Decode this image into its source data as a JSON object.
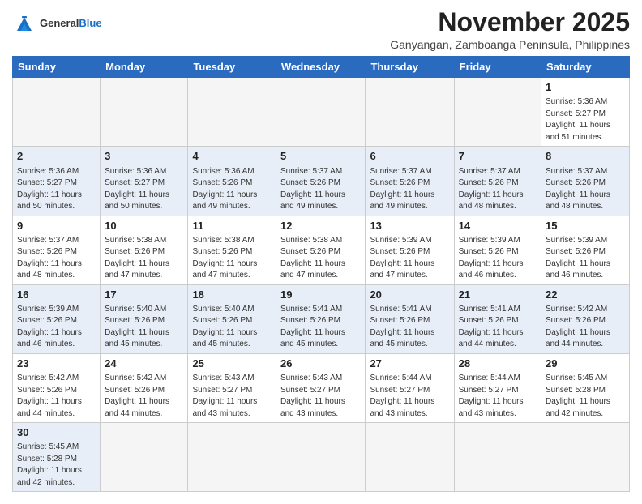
{
  "header": {
    "logo_general": "General",
    "logo_blue": "Blue",
    "month_title": "November 2025",
    "subtitle": "Ganyangan, Zamboanga Peninsula, Philippines"
  },
  "days_of_week": [
    "Sunday",
    "Monday",
    "Tuesday",
    "Wednesday",
    "Thursday",
    "Friday",
    "Saturday"
  ],
  "weeks": [
    [
      {
        "day": "",
        "info": ""
      },
      {
        "day": "",
        "info": ""
      },
      {
        "day": "",
        "info": ""
      },
      {
        "day": "",
        "info": ""
      },
      {
        "day": "",
        "info": ""
      },
      {
        "day": "",
        "info": ""
      },
      {
        "day": "1",
        "info": "Sunrise: 5:36 AM\nSunset: 5:27 PM\nDaylight: 11 hours\nand 51 minutes."
      }
    ],
    [
      {
        "day": "2",
        "info": "Sunrise: 5:36 AM\nSunset: 5:27 PM\nDaylight: 11 hours\nand 50 minutes."
      },
      {
        "day": "3",
        "info": "Sunrise: 5:36 AM\nSunset: 5:27 PM\nDaylight: 11 hours\nand 50 minutes."
      },
      {
        "day": "4",
        "info": "Sunrise: 5:36 AM\nSunset: 5:26 PM\nDaylight: 11 hours\nand 49 minutes."
      },
      {
        "day": "5",
        "info": "Sunrise: 5:37 AM\nSunset: 5:26 PM\nDaylight: 11 hours\nand 49 minutes."
      },
      {
        "day": "6",
        "info": "Sunrise: 5:37 AM\nSunset: 5:26 PM\nDaylight: 11 hours\nand 49 minutes."
      },
      {
        "day": "7",
        "info": "Sunrise: 5:37 AM\nSunset: 5:26 PM\nDaylight: 11 hours\nand 48 minutes."
      },
      {
        "day": "8",
        "info": "Sunrise: 5:37 AM\nSunset: 5:26 PM\nDaylight: 11 hours\nand 48 minutes."
      }
    ],
    [
      {
        "day": "9",
        "info": "Sunrise: 5:37 AM\nSunset: 5:26 PM\nDaylight: 11 hours\nand 48 minutes."
      },
      {
        "day": "10",
        "info": "Sunrise: 5:38 AM\nSunset: 5:26 PM\nDaylight: 11 hours\nand 47 minutes."
      },
      {
        "day": "11",
        "info": "Sunrise: 5:38 AM\nSunset: 5:26 PM\nDaylight: 11 hours\nand 47 minutes."
      },
      {
        "day": "12",
        "info": "Sunrise: 5:38 AM\nSunset: 5:26 PM\nDaylight: 11 hours\nand 47 minutes."
      },
      {
        "day": "13",
        "info": "Sunrise: 5:39 AM\nSunset: 5:26 PM\nDaylight: 11 hours\nand 47 minutes."
      },
      {
        "day": "14",
        "info": "Sunrise: 5:39 AM\nSunset: 5:26 PM\nDaylight: 11 hours\nand 46 minutes."
      },
      {
        "day": "15",
        "info": "Sunrise: 5:39 AM\nSunset: 5:26 PM\nDaylight: 11 hours\nand 46 minutes."
      }
    ],
    [
      {
        "day": "16",
        "info": "Sunrise: 5:39 AM\nSunset: 5:26 PM\nDaylight: 11 hours\nand 46 minutes."
      },
      {
        "day": "17",
        "info": "Sunrise: 5:40 AM\nSunset: 5:26 PM\nDaylight: 11 hours\nand 45 minutes."
      },
      {
        "day": "18",
        "info": "Sunrise: 5:40 AM\nSunset: 5:26 PM\nDaylight: 11 hours\nand 45 minutes."
      },
      {
        "day": "19",
        "info": "Sunrise: 5:41 AM\nSunset: 5:26 PM\nDaylight: 11 hours\nand 45 minutes."
      },
      {
        "day": "20",
        "info": "Sunrise: 5:41 AM\nSunset: 5:26 PM\nDaylight: 11 hours\nand 45 minutes."
      },
      {
        "day": "21",
        "info": "Sunrise: 5:41 AM\nSunset: 5:26 PM\nDaylight: 11 hours\nand 44 minutes."
      },
      {
        "day": "22",
        "info": "Sunrise: 5:42 AM\nSunset: 5:26 PM\nDaylight: 11 hours\nand 44 minutes."
      }
    ],
    [
      {
        "day": "23",
        "info": "Sunrise: 5:42 AM\nSunset: 5:26 PM\nDaylight: 11 hours\nand 44 minutes."
      },
      {
        "day": "24",
        "info": "Sunrise: 5:42 AM\nSunset: 5:26 PM\nDaylight: 11 hours\nand 44 minutes."
      },
      {
        "day": "25",
        "info": "Sunrise: 5:43 AM\nSunset: 5:27 PM\nDaylight: 11 hours\nand 43 minutes."
      },
      {
        "day": "26",
        "info": "Sunrise: 5:43 AM\nSunset: 5:27 PM\nDaylight: 11 hours\nand 43 minutes."
      },
      {
        "day": "27",
        "info": "Sunrise: 5:44 AM\nSunset: 5:27 PM\nDaylight: 11 hours\nand 43 minutes."
      },
      {
        "day": "28",
        "info": "Sunrise: 5:44 AM\nSunset: 5:27 PM\nDaylight: 11 hours\nand 43 minutes."
      },
      {
        "day": "29",
        "info": "Sunrise: 5:45 AM\nSunset: 5:28 PM\nDaylight: 11 hours\nand 42 minutes."
      }
    ],
    [
      {
        "day": "30",
        "info": "Sunrise: 5:45 AM\nSunset: 5:28 PM\nDaylight: 11 hours\nand 42 minutes."
      },
      {
        "day": "",
        "info": ""
      },
      {
        "day": "",
        "info": ""
      },
      {
        "day": "",
        "info": ""
      },
      {
        "day": "",
        "info": ""
      },
      {
        "day": "",
        "info": ""
      },
      {
        "day": "",
        "info": ""
      }
    ]
  ],
  "colors": {
    "header_bg": "#2a6abf",
    "header_text": "#ffffff",
    "even_row_bg": "#e8eef7",
    "odd_row_bg": "#ffffff",
    "empty_cell_bg": "#f5f5f5"
  }
}
